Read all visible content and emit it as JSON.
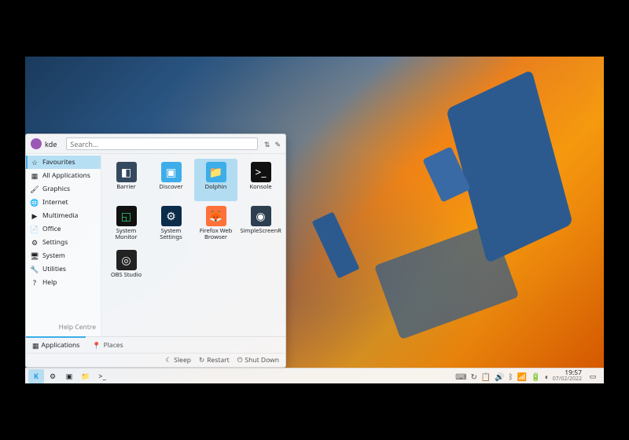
{
  "user": {
    "name": "kde"
  },
  "search": {
    "placeholder": "Search..."
  },
  "sidebar": {
    "items": [
      {
        "label": "Favourites",
        "icon": "☆",
        "selected": true
      },
      {
        "label": "All Applications",
        "icon": "▦"
      },
      {
        "label": "Graphics",
        "icon": "🖌"
      },
      {
        "label": "Internet",
        "icon": "🌐"
      },
      {
        "label": "Multimedia",
        "icon": "▶"
      },
      {
        "label": "Office",
        "icon": "📄"
      },
      {
        "label": "Settings",
        "icon": "⚙"
      },
      {
        "label": "System",
        "icon": "🖥"
      },
      {
        "label": "Utilities",
        "icon": "🔧"
      },
      {
        "label": "Help",
        "icon": "?"
      }
    ],
    "help_centre": "Help Centre"
  },
  "apps": [
    {
      "label": "Barrier",
      "icon": "◧",
      "bg": "#34495e",
      "fg": "#fff"
    },
    {
      "label": "Discover",
      "icon": "▣",
      "bg": "#3daee9",
      "fg": "#fff"
    },
    {
      "label": "Dolphin",
      "icon": "📁",
      "bg": "#3daee9",
      "fg": "#fff",
      "selected": true
    },
    {
      "label": "Konsole",
      "icon": ">_",
      "bg": "#111",
      "fg": "#fff"
    },
    {
      "label": "System Monitor",
      "icon": "◱",
      "bg": "#111",
      "fg": "#2ecc71"
    },
    {
      "label": "System Settings",
      "icon": "⚙",
      "bg": "#0b2d4a",
      "fg": "#fff"
    },
    {
      "label": "Firefox Web Browser",
      "icon": "🦊",
      "bg": "#ff7139",
      "fg": "#fff"
    },
    {
      "label": "SimpleScreenRecorder",
      "icon": "◉",
      "bg": "#2c3e50",
      "fg": "#fff"
    },
    {
      "label": "OBS Studio",
      "icon": "◎",
      "bg": "#222",
      "fg": "#fff"
    }
  ],
  "tabs": [
    {
      "label": "Applications",
      "icon": "▦",
      "active": true
    },
    {
      "label": "Places",
      "icon": "📍"
    }
  ],
  "power": {
    "sleep": "Sleep",
    "restart": "Restart",
    "shutdown": "Shut Down"
  },
  "taskbar": {
    "pinned": [
      {
        "name": "app-launcher",
        "glyph": "K",
        "active": true,
        "cls": "kde-logo"
      },
      {
        "name": "system-settings",
        "glyph": "⚙"
      },
      {
        "name": "discover",
        "glyph": "▣"
      },
      {
        "name": "dolphin",
        "glyph": "📁"
      },
      {
        "name": "konsole",
        "glyph": ">_"
      }
    ],
    "tray": [
      {
        "name": "keyboard-layout",
        "glyph": "⌨"
      },
      {
        "name": "updates",
        "glyph": "↻"
      },
      {
        "name": "clipboard",
        "glyph": "📋"
      },
      {
        "name": "volume",
        "glyph": "🔊"
      },
      {
        "name": "bluetooth",
        "glyph": "ᛒ"
      },
      {
        "name": "network",
        "glyph": "📶"
      },
      {
        "name": "battery",
        "glyph": "🔋"
      },
      {
        "name": "night-color",
        "glyph": "◐"
      }
    ],
    "clock": {
      "time": "19:57",
      "date": "07/02/2022"
    }
  },
  "colors": {
    "accent": "#3daee9"
  }
}
